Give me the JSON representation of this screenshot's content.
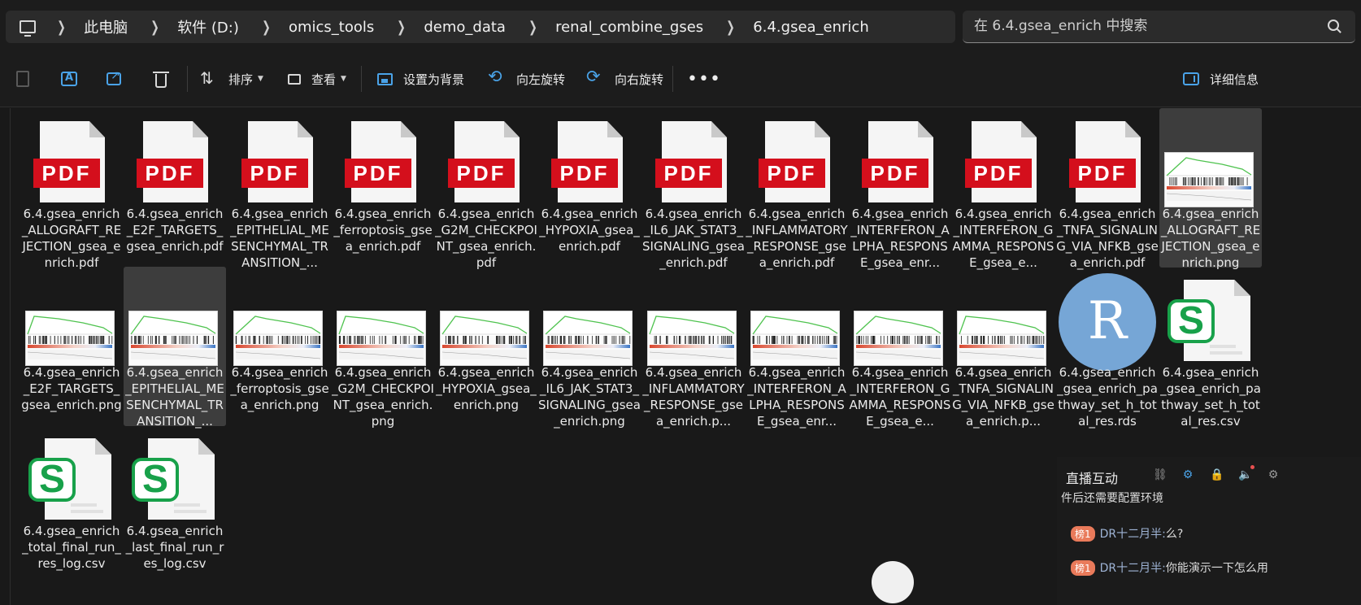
{
  "breadcrumb": [
    "此电脑",
    "软件 (D:)",
    "omics_tools",
    "demo_data",
    "renal_combine_gses",
    "6.4.gsea_enrich"
  ],
  "search": {
    "placeholder": "在 6.4.gsea_enrich 中搜索"
  },
  "toolbar": {
    "sort": "排序",
    "view": "查看",
    "set_background": "设置为背景",
    "rotate_left": "向左旋转",
    "rotate_right": "向右旋转",
    "more": "•••",
    "details": "详细信息"
  },
  "files": [
    {
      "type": "pdf",
      "name": "6.4.gsea_enrich_ALLOGRAFT_REJECTION_gsea_enrich.pdf"
    },
    {
      "type": "pdf",
      "name": "6.4.gsea_enrich_E2F_TARGETS_gsea_enrich.pdf"
    },
    {
      "type": "pdf",
      "name": "6.4.gsea_enrich_EPITHELIAL_MESENCHYMAL_TRANSITION_..."
    },
    {
      "type": "pdf",
      "name": "6.4.gsea_enrich_ferroptosis_gsea_enrich.pdf"
    },
    {
      "type": "pdf",
      "name": "6.4.gsea_enrich_G2M_CHECKPOINT_gsea_enrich.pdf"
    },
    {
      "type": "pdf",
      "name": "6.4.gsea_enrich_HYPOXIA_gsea_enrich.pdf"
    },
    {
      "type": "pdf",
      "name": "6.4.gsea_enrich_IL6_JAK_STAT3_SIGNALING_gsea_enrich.pdf"
    },
    {
      "type": "pdf",
      "name": "6.4.gsea_enrich_INFLAMMATORY_RESPONSE_gsea_enrich.pdf"
    },
    {
      "type": "pdf",
      "name": "6.4.gsea_enrich_INTERFERON_ALPHA_RESPONSE_gsea_enr..."
    },
    {
      "type": "pdf",
      "name": "6.4.gsea_enrich_INTERFERON_GAMMA_RESPONSE_gsea_e..."
    },
    {
      "type": "pdf",
      "name": "6.4.gsea_enrich_TNFA_SIGNALING_VIA_NFKB_gsea_enrich.pdf"
    },
    {
      "type": "png",
      "name": "6.4.gsea_enrich_ALLOGRAFT_REJECTION_gsea_enrich.png",
      "selected": true
    },
    {
      "type": "png",
      "name": "6.4.gsea_enrich_E2F_TARGETS_gsea_enrich.png"
    },
    {
      "type": "png",
      "name": "6.4.gsea_enrich_EPITHELIAL_MESENCHYMAL_TRANSITION_...",
      "selected": true
    },
    {
      "type": "png",
      "name": "6.4.gsea_enrich_ferroptosis_gsea_enrich.png"
    },
    {
      "type": "png",
      "name": "6.4.gsea_enrich_G2M_CHECKPOINT_gsea_enrich.png"
    },
    {
      "type": "png",
      "name": "6.4.gsea_enrich_HYPOXIA_gsea_enrich.png"
    },
    {
      "type": "png",
      "name": "6.4.gsea_enrich_IL6_JAK_STAT3_SIGNALING_gsea_enrich.png"
    },
    {
      "type": "png",
      "name": "6.4.gsea_enrich_INFLAMMATORY_RESPONSE_gsea_enrich.p..."
    },
    {
      "type": "png",
      "name": "6.4.gsea_enrich_INTERFERON_ALPHA_RESPONSE_gsea_enr..."
    },
    {
      "type": "png",
      "name": "6.4.gsea_enrich_INTERFERON_GAMMA_RESPONSE_gsea_e..."
    },
    {
      "type": "png",
      "name": "6.4.gsea_enrich_TNFA_SIGNALING_VIA_NFKB_gsea_enrich.p..."
    },
    {
      "type": "rds",
      "name": "6.4.gsea_enrich_gsea_enrich_pathway_set_h_total_res.rds"
    },
    {
      "type": "csv",
      "name": "6.4.gsea_enrich_gsea_enrich_pathway_set_h_total_res.csv"
    },
    {
      "type": "csv",
      "name": "6.4.gsea_enrich_total_final_run_res_log.csv"
    },
    {
      "type": "csv",
      "name": "6.4.gsea_enrich_last_final_run_res_log.csv"
    }
  ],
  "icons": {
    "pdf_label": "PDF",
    "r_label": "R",
    "csv_label": "S"
  },
  "colors": {
    "pdf_red": "#d40f1c",
    "r_blue": "#76a6d6",
    "sheet_green": "#18a14a",
    "accent": "#4aa3e8"
  },
  "chat": {
    "title": "直播互动",
    "line0": "件后还需要配置环境",
    "messages": [
      {
        "badge": "榜1",
        "user": "DR十二月半:",
        "text": " 么?"
      },
      {
        "badge": "榜1",
        "user": "DR十二月半:",
        "text": " 你能演示一下怎么用"
      }
    ]
  }
}
